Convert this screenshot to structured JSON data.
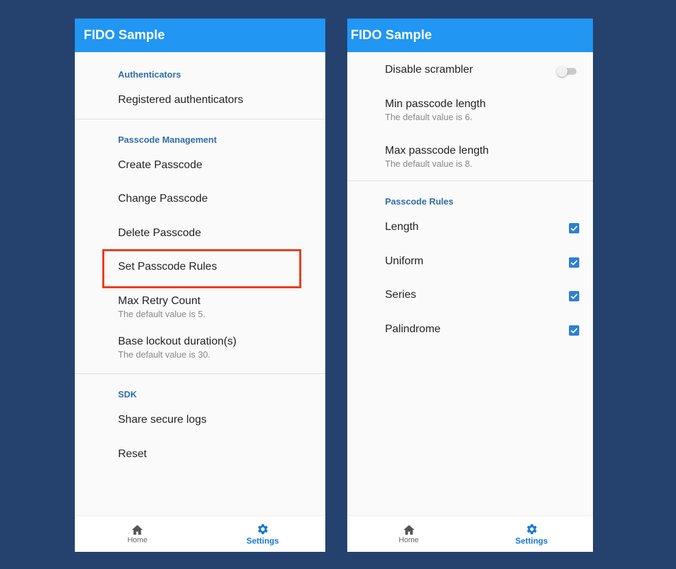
{
  "app_title": "FIDO Sample",
  "left_screen": {
    "sections": [
      {
        "header": "Authenticators",
        "items": [
          {
            "title": "Registered authenticators"
          }
        ]
      },
      {
        "header": "Passcode Management",
        "items": [
          {
            "title": "Create Passcode"
          },
          {
            "title": "Change Passcode"
          },
          {
            "title": "Delete Passcode"
          },
          {
            "title": "Set Passcode Rules",
            "highlighted": true
          },
          {
            "title": "Max Retry Count",
            "subtitle": "The default value is 5."
          },
          {
            "title": "Base lockout duration(s)",
            "subtitle": "The default value is 30."
          }
        ]
      },
      {
        "header": "SDK",
        "items": [
          {
            "title": "Share secure logs"
          },
          {
            "title": "Reset"
          }
        ]
      }
    ]
  },
  "right_screen": {
    "items": [
      {
        "title": "Disable scrambler",
        "toggle": false
      },
      {
        "title": "Min passcode length",
        "subtitle": "The default value is 6."
      },
      {
        "title": "Max passcode length",
        "subtitle": "The default value is 8."
      }
    ],
    "rules_header": "Passcode Rules",
    "rules": [
      {
        "title": "Length",
        "checked": true
      },
      {
        "title": "Uniform",
        "checked": true
      },
      {
        "title": "Series",
        "checked": true
      },
      {
        "title": "Palindrome",
        "checked": true
      }
    ]
  },
  "bottom_nav": {
    "items": [
      {
        "label": "Home",
        "icon": "home-icon",
        "active": false
      },
      {
        "label": "Settings",
        "icon": "gear-icon",
        "active": true
      }
    ]
  },
  "colors": {
    "background": "#25426f",
    "app_bar": "#2196f3",
    "accent": "#2d7fd2",
    "section_header": "#2f6ca8",
    "highlight_box": "#f03a17"
  }
}
